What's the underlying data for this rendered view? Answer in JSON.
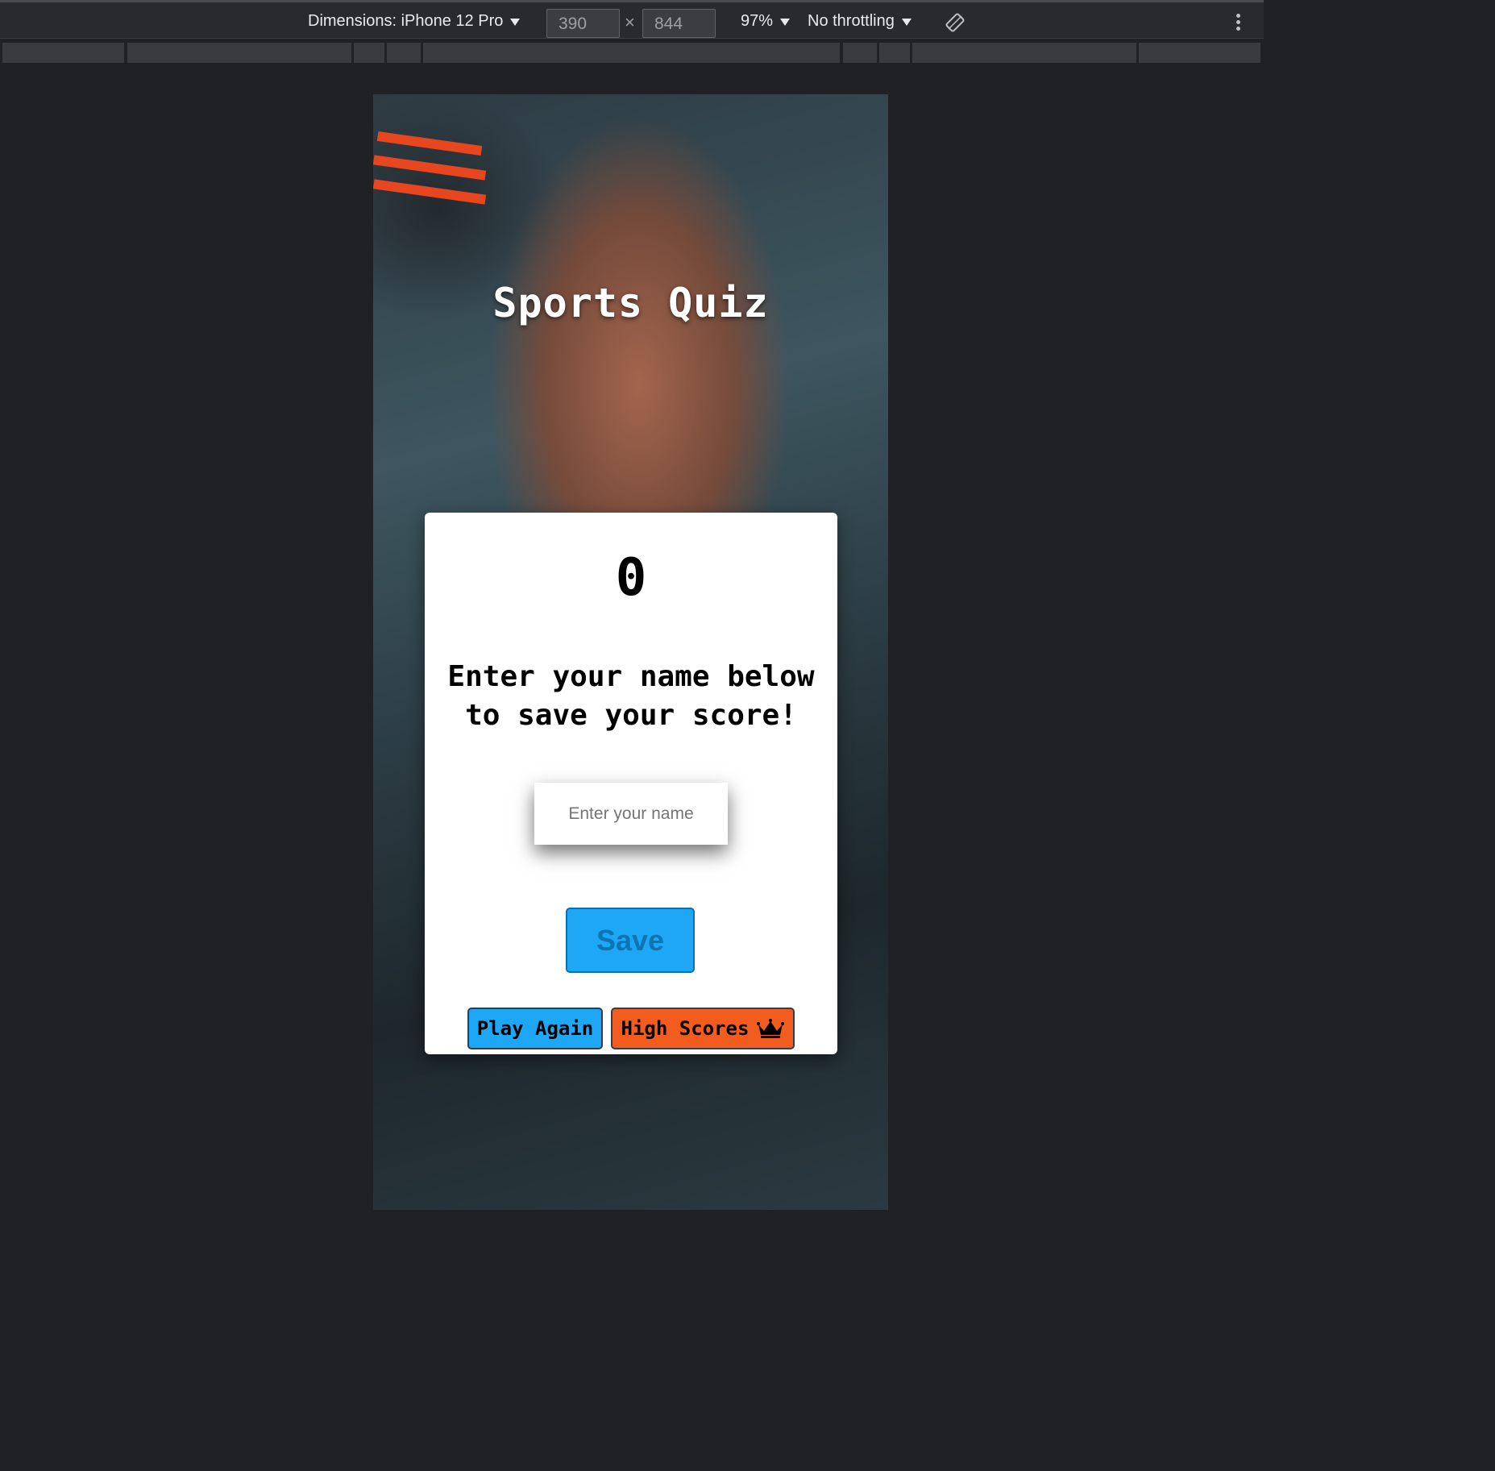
{
  "devtools": {
    "dimensions_label": "Dimensions: iPhone 12 Pro",
    "width_value": "390",
    "times": "×",
    "height_value": "844",
    "zoom": "97%",
    "throttling": "No throttling",
    "rotate_icon": "rotate-icon",
    "more_icon": "kebab-icon"
  },
  "app": {
    "title": "Sports Quiz",
    "score": "0",
    "prompt": "Enter your name below to save your score!",
    "name_placeholder": "Enter your name",
    "save_label": "Save",
    "play_again_label": "Play Again",
    "high_scores_label": "High Scores",
    "high_scores_icon": "crown-icon"
  },
  "colors": {
    "primary_button": "#1ea7f5",
    "secondary_button": "#f25c1f",
    "card": "#ffffff",
    "devtools_bg": "#202124"
  }
}
